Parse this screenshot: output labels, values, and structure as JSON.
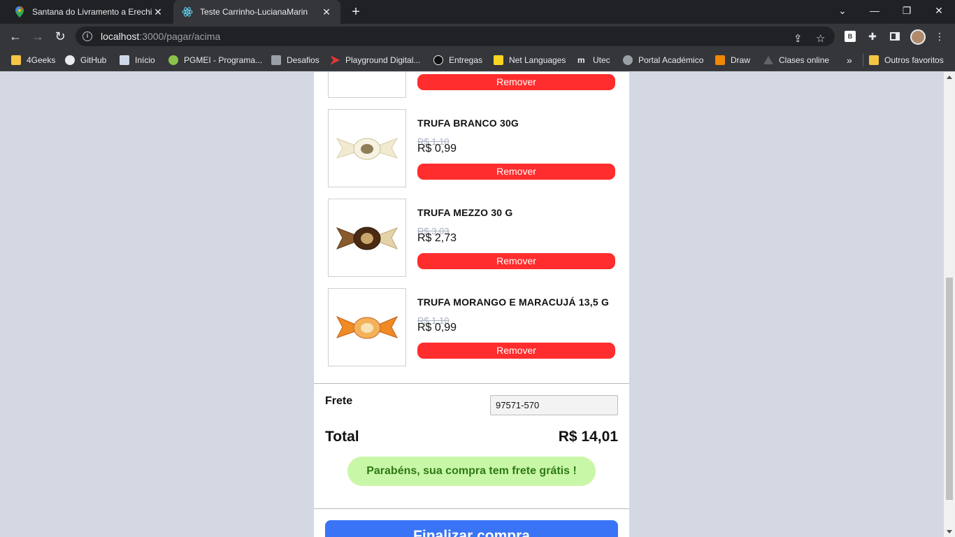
{
  "browser": {
    "tabs": [
      {
        "title": "Santana do Livramento a Erechim",
        "icon": "maps-pin-icon",
        "active": false
      },
      {
        "title": "Teste Carrinho-LucianaMarin",
        "icon": "react-icon",
        "active": true
      }
    ],
    "url_host": "localhost",
    "url_path": ":3000/pagar/acima",
    "bookmarks": [
      "4Geeks",
      "GitHub",
      "Início",
      "PGMEI - Programa...",
      "Desafios",
      "Playground Digital...",
      "Entregas",
      "Net Languages",
      "Utec",
      "Portal Académico",
      "Draw",
      "Clases online"
    ],
    "more_bookmarks": "»",
    "other_favorites": "Outros favoritos",
    "extension_label": "B"
  },
  "cart": {
    "remove_label": "Remover",
    "items": [
      {
        "name": "",
        "old_price": "",
        "price": ""
      },
      {
        "name": "TRUFA BRANCO 30G",
        "old_price": "R$ 1,10",
        "price": "R$ 0,99"
      },
      {
        "name": "TRUFA MEZZO 30 G",
        "old_price": "R$ 3,03",
        "price": "R$ 2,73"
      },
      {
        "name": "TRUFA MORANGO E MARACUJÁ 13,5 G",
        "old_price": "R$ 1,10",
        "price": "R$ 0,99"
      }
    ],
    "frete_label": "Frete",
    "frete_value": "97571-570",
    "total_label": "Total",
    "total_value": "R$ 14,01",
    "free_shipping_message": "Parabéns, sua compra tem frete grátis !",
    "finalize_label": "Finalizar compra"
  },
  "colors": {
    "remove_button": "#ff2d2d",
    "free_shipping_bg": "#c9f7a8",
    "finalize_button": "#3874f5",
    "page_background": "#d3d8e3"
  }
}
